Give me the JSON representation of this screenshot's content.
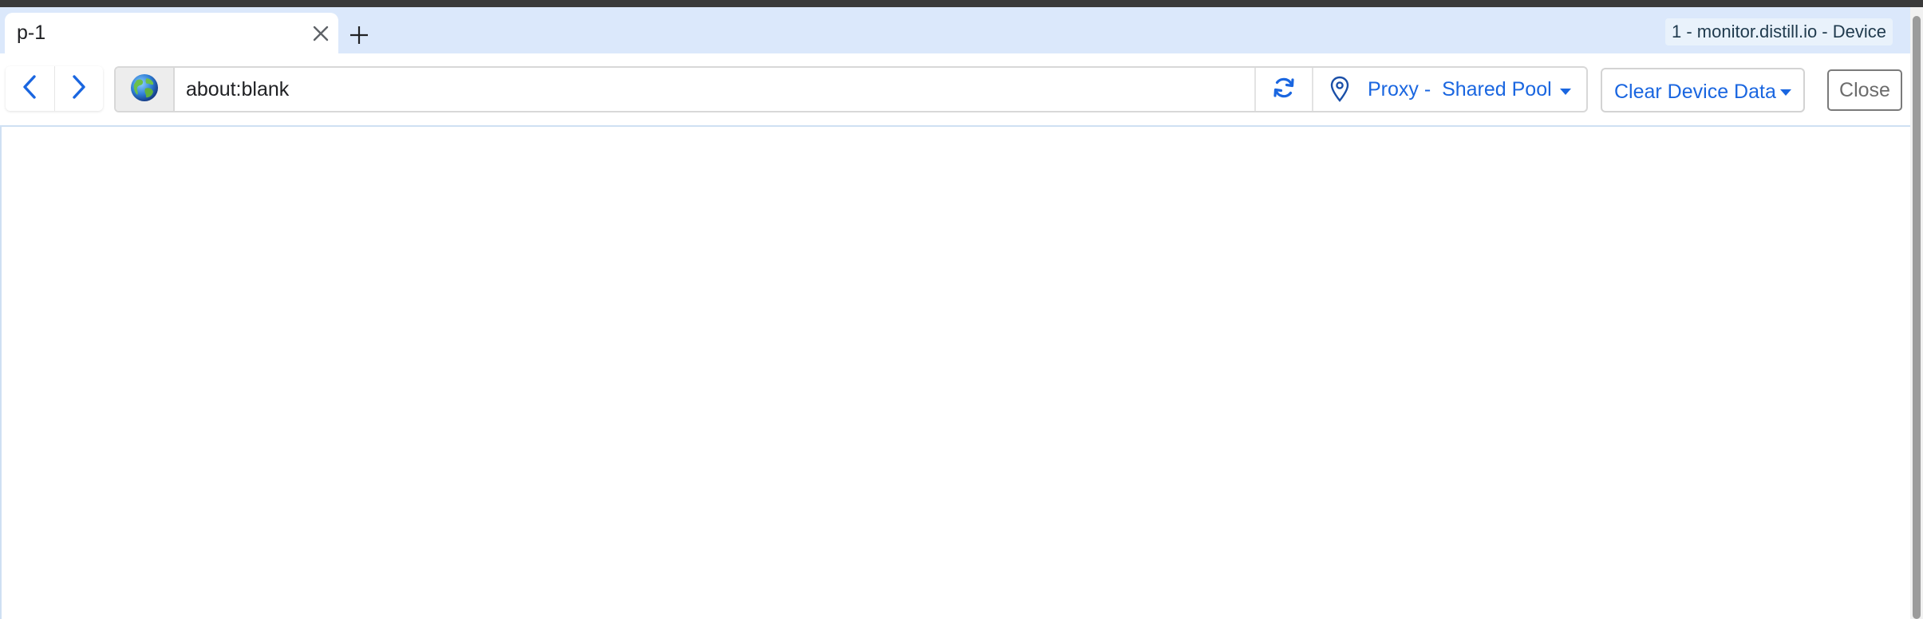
{
  "tab": {
    "title": "p-1"
  },
  "window": {
    "title": "1 - monitor.distill.io - Device"
  },
  "navigation": {
    "back_icon": "chevron-left-icon",
    "forward_icon": "chevron-right-icon"
  },
  "address_bar": {
    "value": "about:blank",
    "site_icon": "globe-icon",
    "reload_icon": "refresh-icon"
  },
  "proxy": {
    "label": "Proxy -  Shared Pool",
    "icon": "map-pin-icon"
  },
  "actions": {
    "clear_label": "Clear Device Data",
    "close_label": "Close"
  },
  "colors": {
    "accent": "#1a66e0",
    "tabstrip": "#dbe8fb",
    "titlebar": "#3a3a3a"
  }
}
